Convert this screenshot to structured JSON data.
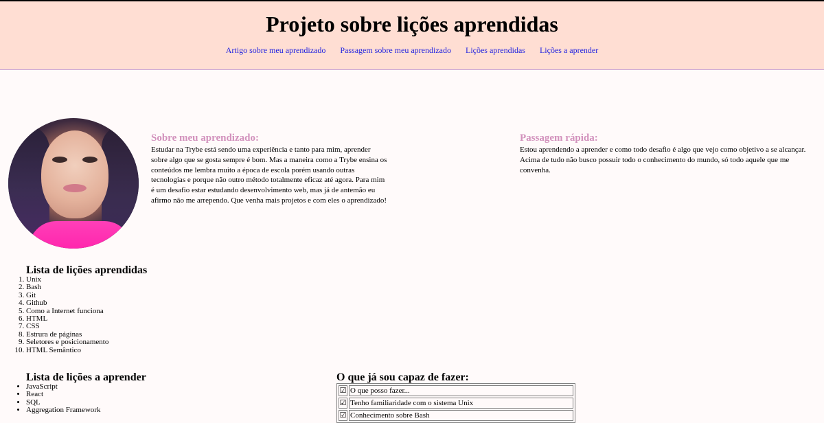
{
  "header": {
    "title": "Projeto sobre lições aprendidas",
    "nav": [
      "Artigo sobre meu aprendizado",
      "Passagem sobre meu aprendizado",
      "Lições aprendidas",
      "Lições a aprender"
    ]
  },
  "about": {
    "title": "Sobre meu aprendizado:",
    "text": "Estudar na Trybe está sendo uma experiência e tanto para mim, aprender sobre algo que se gosta sempre é bom. Mas a maneira como a Trybe ensina os conteúdos me lembra muito a época de escola porém usando outras tecnologias e porque não outro método totalmente eficaz até agora. Para mim é um desafio estar estudando desenvolvimento web, mas já de antemão eu afirmo não me arrependo. Que venha mais projetos e com eles o aprendizado!"
  },
  "passage": {
    "title": "Passagem rápida:",
    "text": "Estou aprendendo a aprender e como todo desafio é algo que vejo como objetivo a se alcançar. Acima de tudo não busco possuir todo o conhecimento do mundo, só todo aquele que me convenha."
  },
  "learned": {
    "title": "Lista de lições aprendidas",
    "items": [
      "Unix",
      "Bash",
      "Git",
      "Github",
      "Como a Internet funciona",
      "HTML",
      "CSS",
      "Estrura de páginas",
      "Seletores e posicionamento",
      "HTML Semântico"
    ]
  },
  "to_learn": {
    "title": "Lista de lições a aprender",
    "items": [
      "JavaScript",
      "React",
      "SQL",
      "Aggregation Framework"
    ]
  },
  "capable": {
    "title": "O que já sou capaz de fazer:",
    "check_glyph": "☑",
    "rows": [
      "O que posso fazer...",
      "Tenho familiaridade com o sistema Unix",
      "Conhecimento sobre Bash"
    ]
  },
  "icons": {
    "avatar": "profile-photo"
  }
}
